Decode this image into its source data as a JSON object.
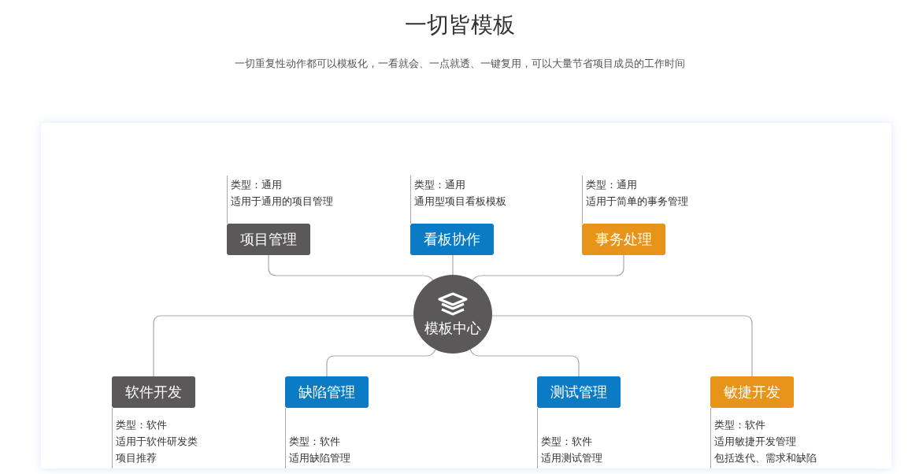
{
  "title": "一切皆模板",
  "subtitle": "一切重复性动作都可以模板化，一看就会、一点就透、一键复用，可以大量节省项目成员的工作时间",
  "center": {
    "label": "模板中心"
  },
  "top_branches": [
    {
      "label": "项目管理",
      "color": "#5a5859",
      "notes": [
        "类型：通用",
        "适用于通用的项目管理"
      ]
    },
    {
      "label": "看板协作",
      "color": "#0c7bc6",
      "notes": [
        "类型：通用",
        "通用型项目看板模板"
      ]
    },
    {
      "label": "事务处理",
      "color": "#e8931a",
      "notes": [
        "类型：通用",
        "适用于简单的事务管理"
      ]
    }
  ],
  "bottom_branches": [
    {
      "label": "软件开发",
      "color": "#5a5859",
      "notes": [
        "类型：软件",
        "适用于软件研发类",
        "项目推荐"
      ]
    },
    {
      "label": "缺陷管理",
      "color": "#0c7bc6",
      "notes": [
        "类型：软件",
        "适用缺陷管理"
      ]
    },
    {
      "label": "测试管理",
      "color": "#0c7bc6",
      "notes": [
        "类型：软件",
        "适用测试管理"
      ]
    },
    {
      "label": "敏捷开发",
      "color": "#e8931a",
      "notes": [
        "类型：软件",
        "适用敏捷开发管理",
        "包括迭代、需求和缺陷"
      ]
    }
  ]
}
